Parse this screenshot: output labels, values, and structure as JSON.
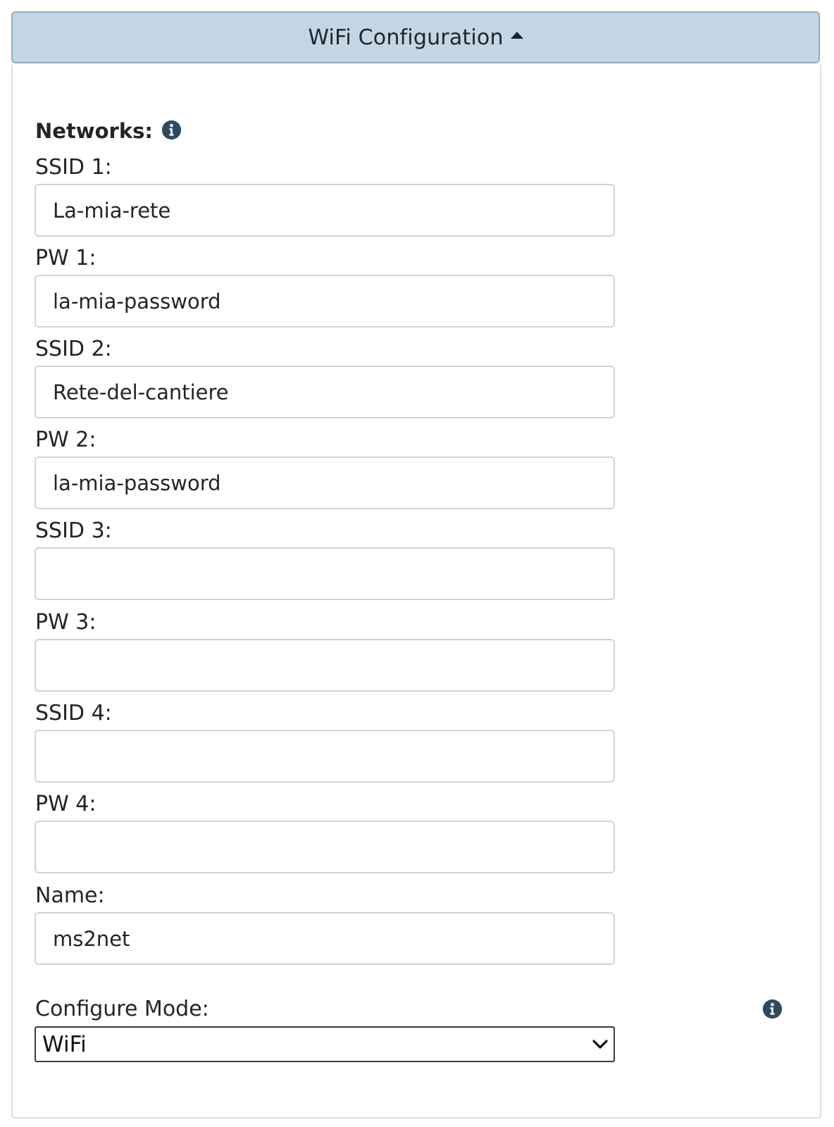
{
  "header": {
    "title": "WiFi Configuration",
    "toggle_icon": "caret-up-icon"
  },
  "networks": {
    "heading": "Networks:",
    "info_icon": "info-circle-icon"
  },
  "fields": [
    {
      "label": "SSID 1:",
      "value": "La-mia-rete"
    },
    {
      "label": "PW 1:",
      "value": "la-mia-password"
    },
    {
      "label": "SSID 2:",
      "value": "Rete-del-cantiere"
    },
    {
      "label": "PW 2:",
      "value": "la-mia-password"
    },
    {
      "label": "SSID 3:",
      "value": ""
    },
    {
      "label": "PW 3:",
      "value": ""
    },
    {
      "label": "SSID 4:",
      "value": ""
    },
    {
      "label": "PW 4:",
      "value": ""
    },
    {
      "label": "Name:",
      "value": "ms2net"
    }
  ],
  "configure_mode": {
    "label": "Configure Mode:",
    "selected": "WiFi",
    "info_icon": "info-circle-icon"
  },
  "colors": {
    "header_bg": "#c3d6e5",
    "header_border": "#8eaec6",
    "info_icon": "#2f4a5e"
  }
}
